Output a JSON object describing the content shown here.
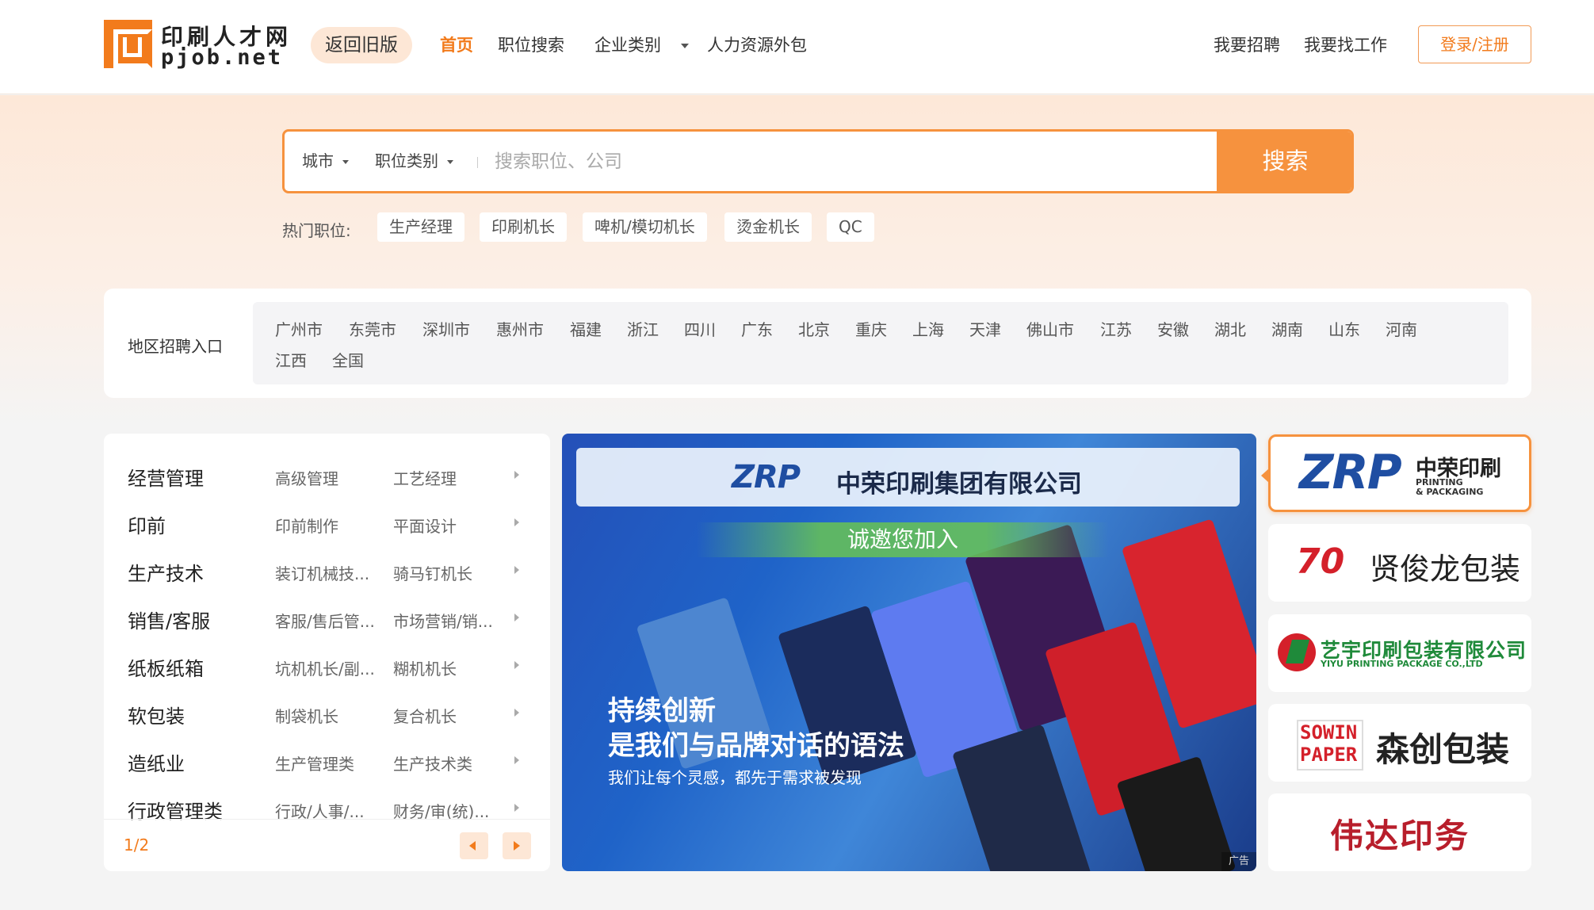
{
  "header": {
    "logo_cn": "印刷人才网",
    "logo_en": "pjob.net",
    "back_old": "返回旧版",
    "nav": [
      "首页",
      "职位搜索",
      "企业类别",
      "人力资源外包"
    ],
    "recruit": "我要招聘",
    "find_job": "我要找工作",
    "login": "登录/注册"
  },
  "search": {
    "city": "城市",
    "category": "职位类别",
    "placeholder": "搜索职位、公司",
    "button": "搜索",
    "hot_label": "热门职位:",
    "hot_tags": [
      "生产经理",
      "印刷机长",
      "啤机/模切机长",
      "烫金机长",
      "QC"
    ]
  },
  "region": {
    "title": "地区招聘入口",
    "cities": [
      "广州市",
      "东莞市",
      "深圳市",
      "惠州市",
      "福建",
      "浙江",
      "四川",
      "广东",
      "北京",
      "重庆",
      "上海",
      "天津",
      "佛山市",
      "江苏",
      "安徽",
      "湖北",
      "湖南",
      "山东",
      "河南",
      "江西",
      "全国"
    ]
  },
  "categories": [
    {
      "main": "经营管理",
      "sub1": "高级管理",
      "sub2": "工艺经理"
    },
    {
      "main": "印前",
      "sub1": "印前制作",
      "sub2": "平面设计"
    },
    {
      "main": "生产技术",
      "sub1": "装订机械技...",
      "sub2": "骑马钉机长"
    },
    {
      "main": "销售/客服",
      "sub1": "客服/售后管...",
      "sub2": "市场营销/销..."
    },
    {
      "main": "纸板纸箱",
      "sub1": "坑机机长/副...",
      "sub2": "糊机机长"
    },
    {
      "main": "软包装",
      "sub1": "制袋机长",
      "sub2": "复合机长"
    },
    {
      "main": "造纸业",
      "sub1": "生产管理类",
      "sub2": "生产技术类"
    },
    {
      "main": "行政管理类",
      "sub1": "行政/人事/...",
      "sub2": "财务/审(统)..."
    }
  ],
  "pagination": "1/2",
  "banner": {
    "brand": "ZRP",
    "company": "中荣印刷集团有限公司",
    "invite": "诚邀您加入",
    "line1": "持续创新",
    "line2": "是我们与品牌对话的语法",
    "line3": "我们让每个灵感，都先于需求被发现",
    "ad": "广告"
  },
  "brands": {
    "zrp": {
      "mark": "ZRP",
      "cn": "中荣印刷",
      "en1": "PRINTING",
      "en2": "& PACKAGING"
    },
    "xjl": {
      "mark": "70",
      "cn": "贤俊龙包装"
    },
    "yiyu": {
      "cn": "艺宇印刷包装有限公司",
      "en": "YIYU PRINTING PACKAGE CO.,LTD"
    },
    "senchuang": {
      "mark1": "SOWIN",
      "mark2": "PAPER",
      "cn": "森创包装"
    },
    "weida": {
      "cn": "伟达印务"
    }
  },
  "colors": {
    "accent": "#f27b1c",
    "accent_light": "#fde7d6"
  }
}
